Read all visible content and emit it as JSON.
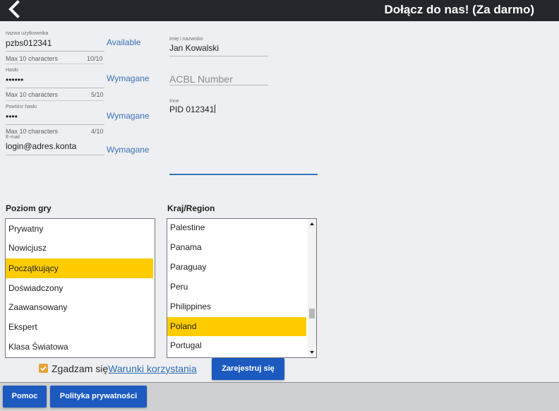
{
  "header": {
    "title": "Dołącz do nas! (Za darmo)",
    "back_icon": "chevron-left-icon"
  },
  "fields": {
    "username": {
      "label": "nazwa użytkownika",
      "value": "pzbs012341",
      "hint": "Max 10 characters",
      "counter": "10/10",
      "status": "Available"
    },
    "password": {
      "label": "Hasło",
      "value": "••••••",
      "hint": "Max 10 characters",
      "counter": "5/10",
      "status": "Wymagane"
    },
    "password_repeat": {
      "label": "Powtórz hasło",
      "value": "••••",
      "hint": "Max 10 characters",
      "counter": "4/10",
      "status": "Wymagane"
    },
    "email": {
      "label": "E-mail",
      "value": "login@adres.konta",
      "status": "Wymagane"
    },
    "fullname": {
      "label": "Imię i nazwisko",
      "value": "Jan Kowalski"
    },
    "acbl": {
      "placeholder": "ACBL Number"
    },
    "other": {
      "label": "Inne",
      "value": "PID 012341"
    }
  },
  "level": {
    "label": "Poziom gry",
    "items": [
      "Prywatny",
      "Nowicjusz",
      "Początkujący",
      "Doświadczony",
      "Zaawansowany",
      "Ekspert",
      "Klasa Światowa"
    ],
    "selected": "Początkujący"
  },
  "country": {
    "label": "Kraj/Region",
    "items": [
      "Palestine",
      "Panama",
      "Paraguay",
      "Peru",
      "Philippines",
      "Poland",
      "Portugal"
    ],
    "selected": "Poland"
  },
  "agree": {
    "text": "Zgadzam się",
    "link": "Warunki korzystania",
    "checked": true
  },
  "buttons": {
    "register": "Zarejestruj się",
    "help": "Pomoc",
    "privacy": "Polityka prywatności"
  },
  "colors": {
    "header": "#23262b",
    "accent_blue": "#1c5ac0",
    "selection": "#ffcc00",
    "link": "#2f6fb5",
    "checkbox": "#e8a33a"
  }
}
